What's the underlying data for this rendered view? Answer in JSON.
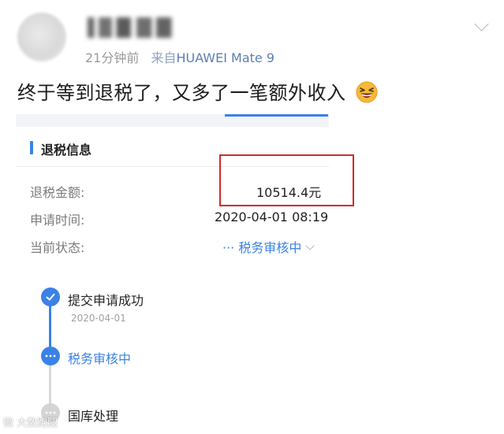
{
  "post": {
    "time_ago": "21分钟前",
    "source_prefix": "来自",
    "device": "HUAWEI Mate 9",
    "text": "终于等到退税了，又多了一笔额外收入",
    "emoji": "grinning-squinting-face"
  },
  "card": {
    "section_title": "退税信息",
    "rows": [
      {
        "label": "退税金额:",
        "value": "10514.4元"
      },
      {
        "label": "申请时间:",
        "value": "2020-04-01 08:19"
      },
      {
        "label": "当前状态:",
        "value": "··· 税务审核中"
      }
    ],
    "timeline": [
      {
        "label": "提交申请成功",
        "date": "2020-04-01",
        "state": "done"
      },
      {
        "label": "税务审核中",
        "state": "current"
      },
      {
        "label": "国库处理",
        "state": "pending"
      }
    ]
  },
  "watermark": "微 大数跑腿",
  "colors": {
    "accent": "#3b82e6",
    "highlight_box": "#d22a2a"
  }
}
